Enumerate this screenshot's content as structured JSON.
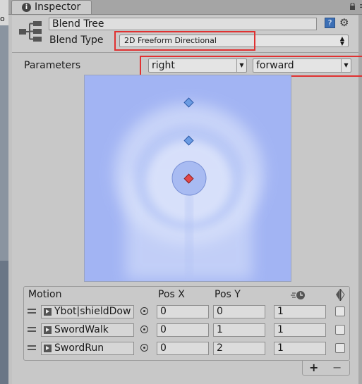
{
  "window": {
    "tab_title": "Inspector",
    "left_strip_text": "o"
  },
  "header": {
    "name_value": "Blend Tree",
    "blend_type_label": "Blend Type",
    "blend_type_value": "2D Freeform Directional",
    "help_glyph": "?"
  },
  "parameters": {
    "label": "Parameters",
    "x_param": "right",
    "y_param": "forward"
  },
  "motion_list": {
    "headers": {
      "motion": "Motion",
      "pos_x": "Pos X",
      "pos_y": "Pos Y"
    },
    "rows": [
      {
        "clip": "Ybot|shieldDow",
        "pos_x": "0",
        "pos_y": "0",
        "speed": "1"
      },
      {
        "clip": "SwordWalk",
        "pos_x": "0",
        "pos_y": "1",
        "speed": "1"
      },
      {
        "clip": "SwordRun",
        "pos_x": "0",
        "pos_y": "2",
        "speed": "1"
      }
    ],
    "add_glyph": "+",
    "remove_glyph": "−"
  },
  "colors": {
    "highlight_red": "#e03131",
    "graph_bg": "#a2b4f3",
    "selected_point": "#e2474a",
    "point": "#6b9ce3"
  }
}
